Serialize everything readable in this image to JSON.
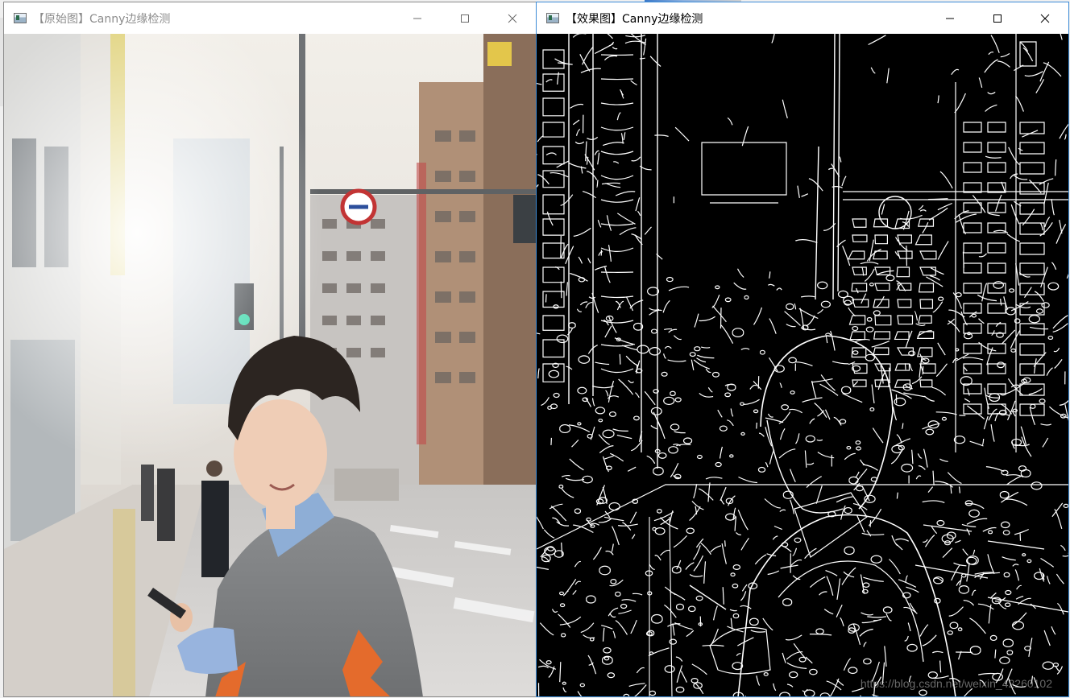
{
  "windows": [
    {
      "id": "original",
      "title": "【原始图】Canny边缘检测",
      "icon": "app-image-icon",
      "controls": [
        "minimize-icon",
        "maximize-icon",
        "close-icon"
      ],
      "image": "street photo of a young man holding a phone, city buildings behind"
    },
    {
      "id": "result",
      "title": "【效果图】Canny边缘检测",
      "icon": "app-image-icon",
      "controls": [
        "minimize-icon",
        "maximize-icon",
        "close-icon"
      ],
      "image": "canny edge detection output: white edges on black",
      "watermark": "https://blog.csdn.net/weixin_42260102"
    }
  ],
  "colors": {
    "active_border": "#3c8bd6",
    "inactive_title": "#8c8c8c",
    "edge_background": "#000000",
    "edge_lines": "#ffffff"
  }
}
